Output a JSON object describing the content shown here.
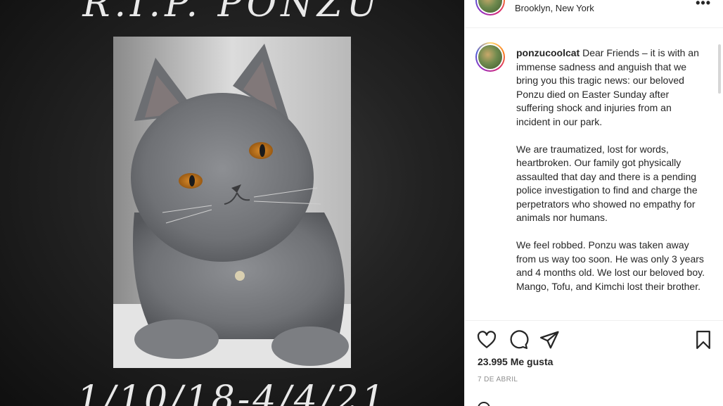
{
  "image": {
    "title": "R.I.P. PONZU",
    "dates": "1/10/18-4/4/21"
  },
  "header": {
    "location": "Brooklyn, New York",
    "more_icon": "more-horizontal-icon"
  },
  "caption": {
    "username": "ponzucoolcat",
    "paragraphs": [
      "Dear Friends – it is with an immense sadness and anguish that we bring you this tragic news: our beloved Ponzu died on Easter Sunday after suffering shock and injuries from an incident in our park.",
      "We are traumatized, lost for words, heartbroken. Our family got physically assaulted that day and there is a pending police investigation to find and charge the perpetrators who showed no empathy for animals nor humans.",
      "We feel robbed. Ponzu was taken away from us way too soon. He was only 3 years and 4 months old. We lost our beloved boy. Mango, Tofu, and Kimchi lost their brother."
    ]
  },
  "actions": {
    "icons": [
      "heart-icon",
      "comment-icon",
      "share-icon",
      "bookmark-icon"
    ],
    "likes": "23.995 Me gusta",
    "date": "7 DE ABRIL"
  },
  "colors": {
    "text": "#262626",
    "muted": "#8e8e8e",
    "border": "#efefef",
    "image_bg": "#1c1c1c"
  }
}
